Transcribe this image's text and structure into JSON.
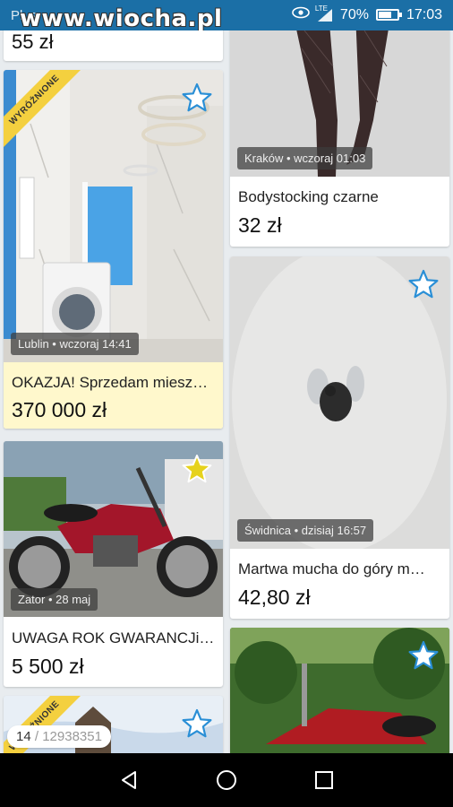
{
  "status_bar": {
    "carrier": "Plus",
    "watermark": "www.wiocha.pl",
    "network": "LTE",
    "battery_percent": "70%",
    "battery_level": 0.7,
    "time": "17:03"
  },
  "listings": [
    {
      "price": "55 zł"
    },
    {
      "badge": "WYRÓŻNIONE",
      "location": "Lublin • wczoraj 14:41",
      "title": "OKAZJA! Sprzedam miesz…",
      "price": "370 000 zł",
      "favorite": false
    },
    {
      "location": "Zator • 28 maj",
      "title": "UWAGA ROK GWARANCJi…",
      "price": "5 500 zł",
      "favorite": true
    },
    {
      "badge": "WYRÓŻNIONE",
      "favorite": false
    },
    {
      "location": "Kraków • wczoraj 01:03",
      "title": "Bodystocking czarne",
      "price": "32 zł"
    },
    {
      "location": "Świdnica • dzisiaj 16:57",
      "title": "Martwa mucha do góry m…",
      "price": "42,80 zł",
      "favorite": false
    },
    {
      "favorite": false
    }
  ],
  "counter": {
    "current": "14",
    "separator": "/",
    "total": "12938351"
  },
  "nav": {
    "back": "back-icon",
    "home": "home-icon",
    "recents": "recents-icon"
  },
  "colors": {
    "status_bar": "#1b6fa6",
    "promoted_bg": "#fff8cc",
    "badge": "#f4d03f",
    "star_outline": "#2a8fd6",
    "star_active": "#e6d21c"
  }
}
